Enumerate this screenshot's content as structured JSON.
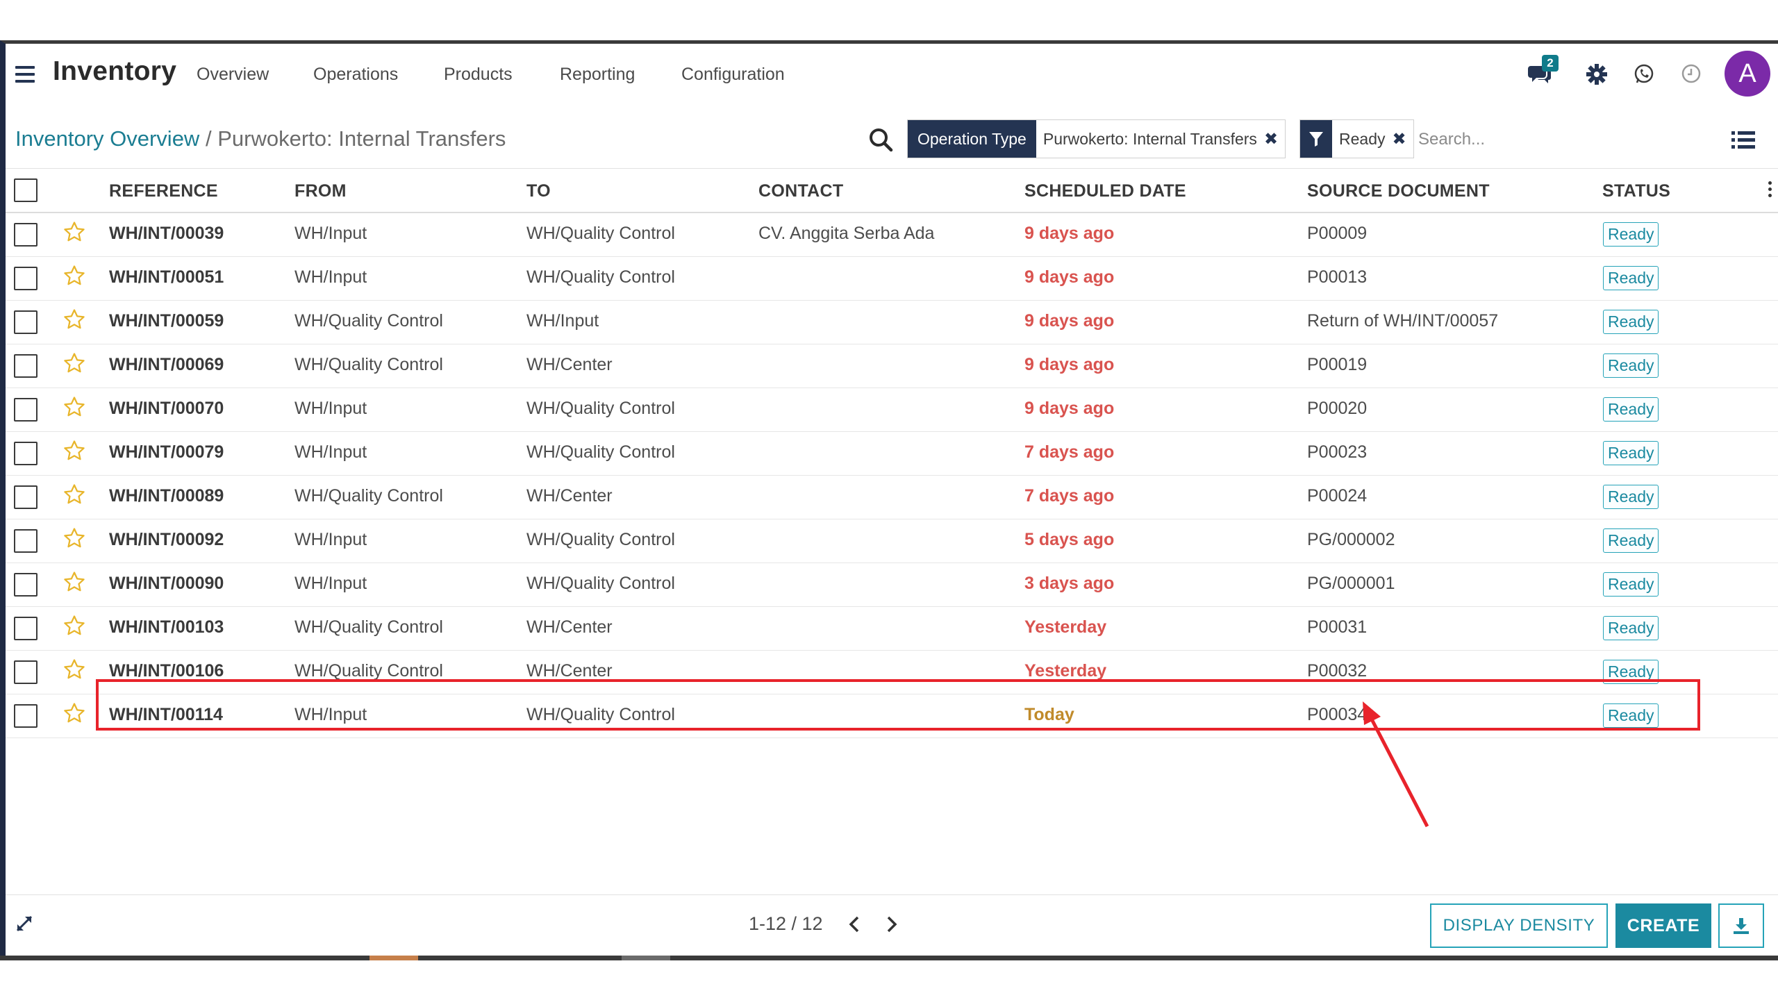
{
  "app": {
    "title": "Inventory",
    "menu": [
      "Overview",
      "Operations",
      "Products",
      "Reporting",
      "Configuration"
    ],
    "messages_count": "2",
    "avatar_initial": "A",
    "avatar_color": "#7b2aa8",
    "icons": [
      "menu-icon",
      "chat-icon",
      "gear-icon",
      "whatsapp-icon",
      "clock-icon"
    ]
  },
  "breadcrumb": {
    "parent": "Inventory Overview",
    "separator": "/",
    "current": "Purwokerto: Internal Transfers"
  },
  "search": {
    "facets": [
      {
        "label": "Operation Type",
        "value": "Purwokerto: Internal Transfers"
      },
      {
        "label": "filter-icon",
        "value": "Ready"
      }
    ],
    "placeholder": "Search..."
  },
  "table": {
    "columns": [
      "REFERENCE",
      "FROM",
      "TO",
      "CONTACT",
      "SCHEDULED DATE",
      "SOURCE DOCUMENT",
      "STATUS"
    ],
    "rows": [
      {
        "reference": "WH/INT/00039",
        "from": "WH/Input",
        "to": "WH/Quality Control",
        "contact": "CV. Anggita Serba Ada",
        "scheduled": "9 days ago",
        "source": "P00009",
        "status": "Ready"
      },
      {
        "reference": "WH/INT/00051",
        "from": "WH/Input",
        "to": "WH/Quality Control",
        "contact": "",
        "scheduled": "9 days ago",
        "source": "P00013",
        "status": "Ready"
      },
      {
        "reference": "WH/INT/00059",
        "from": "WH/Quality Control",
        "to": "WH/Input",
        "contact": "",
        "scheduled": "9 days ago",
        "source": "Return of WH/INT/00057",
        "status": "Ready"
      },
      {
        "reference": "WH/INT/00069",
        "from": "WH/Quality Control",
        "to": "WH/Center",
        "contact": "",
        "scheduled": "9 days ago",
        "source": "P00019",
        "status": "Ready"
      },
      {
        "reference": "WH/INT/00070",
        "from": "WH/Input",
        "to": "WH/Quality Control",
        "contact": "",
        "scheduled": "9 days ago",
        "source": "P00020",
        "status": "Ready"
      },
      {
        "reference": "WH/INT/00079",
        "from": "WH/Input",
        "to": "WH/Quality Control",
        "contact": "",
        "scheduled": "7 days ago",
        "source": "P00023",
        "status": "Ready"
      },
      {
        "reference": "WH/INT/00089",
        "from": "WH/Quality Control",
        "to": "WH/Center",
        "contact": "",
        "scheduled": "7 days ago",
        "source": "P00024",
        "status": "Ready"
      },
      {
        "reference": "WH/INT/00092",
        "from": "WH/Input",
        "to": "WH/Quality Control",
        "contact": "",
        "scheduled": "5 days ago",
        "source": "PG/000002",
        "status": "Ready"
      },
      {
        "reference": "WH/INT/00090",
        "from": "WH/Input",
        "to": "WH/Quality Control",
        "contact": "",
        "scheduled": "3 days ago",
        "source": "PG/000001",
        "status": "Ready"
      },
      {
        "reference": "WH/INT/00103",
        "from": "WH/Quality Control",
        "to": "WH/Center",
        "contact": "",
        "scheduled": "Yesterday",
        "source": "P00031",
        "status": "Ready"
      },
      {
        "reference": "WH/INT/00106",
        "from": "WH/Quality Control",
        "to": "WH/Center",
        "contact": "",
        "scheduled": "Yesterday",
        "source": "P00032",
        "status": "Ready"
      },
      {
        "reference": "WH/INT/00114",
        "from": "WH/Input",
        "to": "WH/Quality Control",
        "contact": "",
        "scheduled": "Today",
        "source": "P00034",
        "status": "Ready"
      }
    ]
  },
  "pager": {
    "range": "1-12 / 12"
  },
  "buttons": {
    "display_density": "DISPLAY DENSITY",
    "create": "CREATE"
  },
  "colors": {
    "navy": "#243452",
    "accent": "#1b8aa0",
    "overdue": "#d9534f",
    "today": "#c08a2a",
    "highlight": "#e8232b"
  }
}
